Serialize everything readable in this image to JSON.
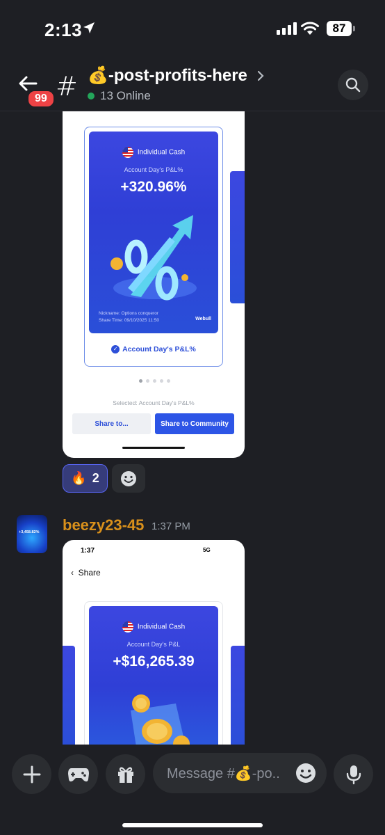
{
  "status_bar": {
    "time": "2:13",
    "battery": "87"
  },
  "header": {
    "unread_count": "99",
    "channel_emoji": "💰",
    "channel_name": "-post-profits-here",
    "online": "13 Online"
  },
  "message1": {
    "attachment": {
      "card_title": "Individual Cash",
      "card_subtitle": "Account Day's P&L%",
      "card_value": "+320.96%",
      "nickname": "Nickname: Options conqueror",
      "share_time": "Share Time: 09/10/2025 11:50",
      "brand": "Webull",
      "option_label": "Account Day's P&L%",
      "selected_label": "Selected:  Account Day's P&L%",
      "share_to_button": "Share to...",
      "share_community_button": "Share to Community"
    },
    "reactions": [
      {
        "emoji": "🔥",
        "count": "2"
      }
    ]
  },
  "message2": {
    "username": "beezy23-45",
    "timestamp": "1:37 PM",
    "avatar_text": "+3,458.82%",
    "attachment": {
      "time": "1:37",
      "network": "5G",
      "back_label": "Share",
      "card_title": "Individual Cash",
      "card_subtitle": "Account Day's P&L",
      "card_value": "+$16,265.39"
    }
  },
  "composer": {
    "placeholder": "Message #💰-po.."
  },
  "colors": {
    "background": "#1e1f24",
    "accent": "#5865f2",
    "username": "#d9901b",
    "online": "#23a55a",
    "badge": "#ed4245",
    "card_blue": "#2f3fd6"
  },
  "icons": [
    "location-arrow-icon",
    "signal-icon",
    "wifi-icon",
    "back-arrow-icon",
    "chevron-right-icon",
    "search-icon",
    "smiley-add-icon",
    "plus-icon",
    "gamepad-icon",
    "gift-icon",
    "emoji-icon",
    "microphone-icon"
  ]
}
